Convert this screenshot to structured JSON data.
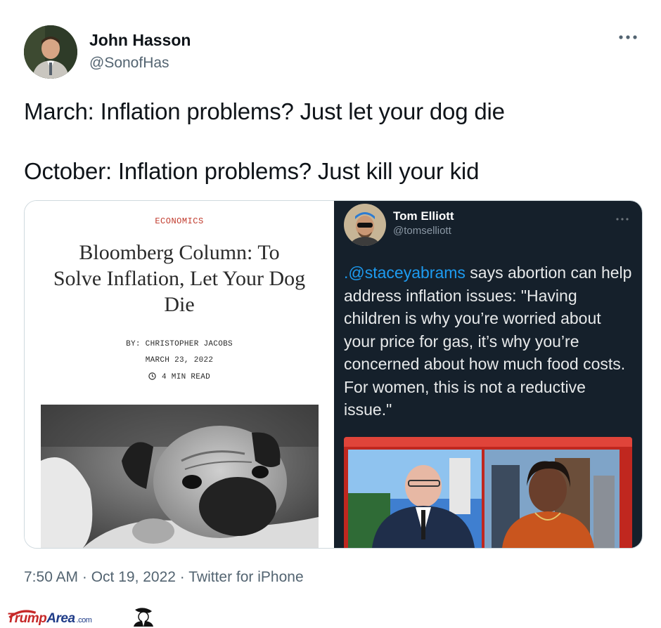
{
  "tweet": {
    "author_name": "John Hasson",
    "author_handle": "@SonofHas",
    "text_line1": "March: Inflation problems? Just let your dog die",
    "text_line2": "October: Inflation problems? Just kill your kid",
    "timestamp": "7:50 AM · Oct 19, 2022 · Twitter for iPhone",
    "icons": {
      "more": "more-options-icon",
      "avatar": "profile-avatar"
    }
  },
  "article": {
    "kicker": "ECONOMICS",
    "headline": "Bloomberg Column: To Solve Inflation, Let Your Dog Die",
    "byline": "BY: CHRISTOPHER JACOBS",
    "date": "MARCH 23, 2022",
    "read_time": "4 MIN READ",
    "kicker_color": "#c0392b"
  },
  "quoted_tweet": {
    "author_name": "Tom Elliott",
    "author_handle": "@tomselliott",
    "mention": ".@staceyabrams",
    "text": " says abortion can help address inflation issues: \"Having children is why you’re worried about your price for gas, it’s why you’re concerned about how much food costs. For women, this is not a reductive issue.\"",
    "background_color": "#15202b",
    "mention_color": "#1d9bf0"
  },
  "watermark": {
    "brand_part1": "Trump",
    "brand_part2": "Area",
    "brand_suffix": ".com"
  }
}
